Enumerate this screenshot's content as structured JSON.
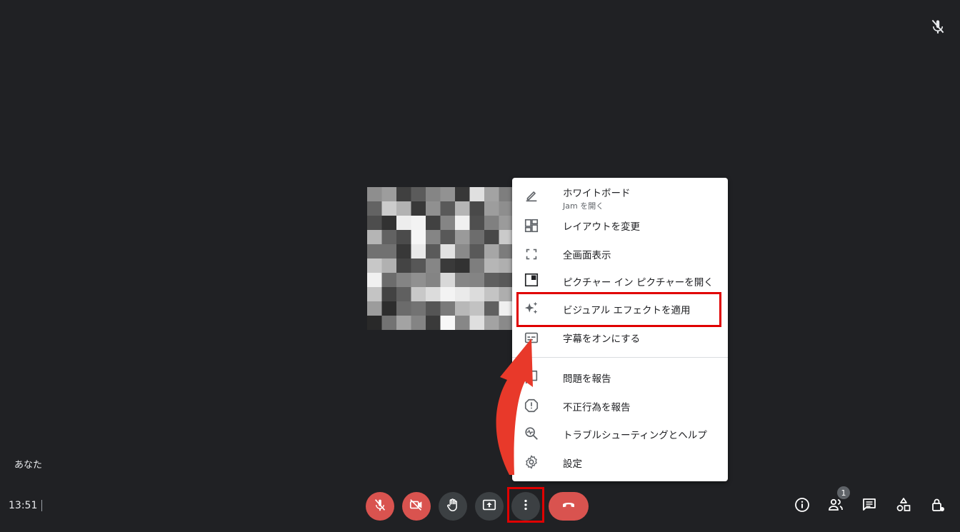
{
  "participant": {
    "label": "あなた"
  },
  "footer": {
    "time": "13:51",
    "participants_count": "1"
  },
  "menu": {
    "items": [
      {
        "label": "ホワイトボード",
        "sublabel": "Jam を開く",
        "icon": "pen-icon"
      },
      {
        "label": "レイアウトを変更",
        "icon": "layout-icon"
      },
      {
        "label": "全画面表示",
        "icon": "fullscreen-icon"
      },
      {
        "label": "ピクチャー イン ピクチャーを開く",
        "icon": "pip-icon"
      },
      {
        "label": "ビジュアル エフェクトを適用",
        "icon": "sparkle-icon"
      },
      {
        "label": "字幕をオンにする",
        "icon": "captions-icon"
      },
      {
        "label": "問題を報告",
        "icon": "feedback-icon"
      },
      {
        "label": "不正行為を報告",
        "icon": "report-icon"
      },
      {
        "label": "トラブルシューティングとヘルプ",
        "icon": "troubleshoot-icon"
      },
      {
        "label": "設定",
        "icon": "gear-icon"
      }
    ]
  },
  "colors": {
    "background": "#202124",
    "control_red": "#d9534f",
    "control_grey": "#3c4043",
    "highlight": "#e00000",
    "arrow": "#e8392a"
  }
}
